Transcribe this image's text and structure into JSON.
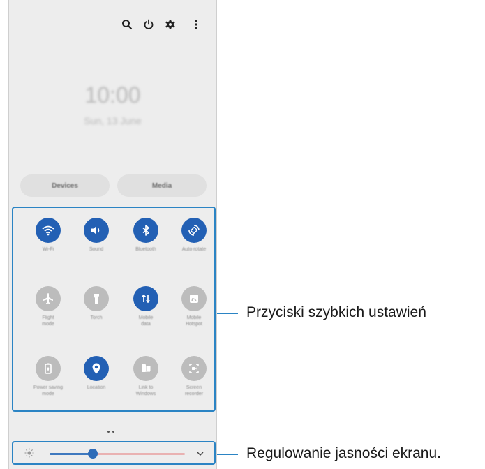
{
  "header": {
    "icons": [
      "search-icon",
      "power-icon",
      "gear-icon",
      "more-vertical-icon"
    ]
  },
  "clock": {
    "time": "10:00",
    "date": "Sun, 13 June"
  },
  "buttons": {
    "devices": "Devices",
    "media": "Media"
  },
  "quick_settings": [
    {
      "label": "Wi-Fi",
      "icon": "wifi-icon",
      "active": true
    },
    {
      "label": "Sound",
      "icon": "sound-icon",
      "active": true
    },
    {
      "label": "Bluetooth",
      "icon": "bluetooth-icon",
      "active": true
    },
    {
      "label": "Auto rotate",
      "icon": "auto-rotate-icon",
      "active": true
    },
    {
      "label": "Flight\nmode",
      "icon": "airplane-icon",
      "active": false
    },
    {
      "label": "Torch",
      "icon": "torch-icon",
      "active": false
    },
    {
      "label": "Mobile\ndata",
      "icon": "mobile-data-icon",
      "active": true
    },
    {
      "label": "Mobile\nHotspot",
      "icon": "hotspot-icon",
      "active": false
    },
    {
      "label": "Power saving\nmode",
      "icon": "power-saving-icon",
      "active": false
    },
    {
      "label": "Location",
      "icon": "location-icon",
      "active": true
    },
    {
      "label": "Link to\nWindows",
      "icon": "link-windows-icon",
      "active": false
    },
    {
      "label": "Screen\nrecorder",
      "icon": "screen-recorder-icon",
      "active": false
    }
  ],
  "brightness": {
    "level_fraction": 0.28
  },
  "callouts": {
    "quick_settings": "Przyciski szybkich ustawień",
    "brightness": "Regulowanie jasności ekranu."
  },
  "colors": {
    "accent": "#2360b4",
    "highlight": "#2b84c4",
    "inactive": "#bcbcbc"
  }
}
